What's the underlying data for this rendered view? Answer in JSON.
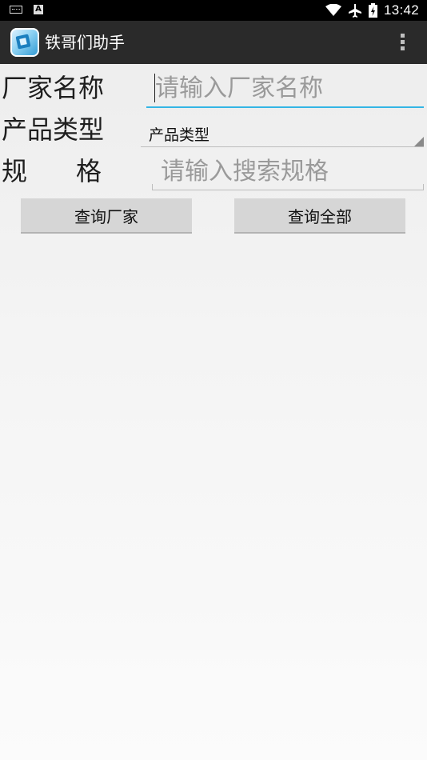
{
  "status_bar": {
    "time": "13:42",
    "left_icons": [
      "keyboard-icon",
      "a-notification-icon"
    ],
    "right_icons": [
      "wifi-icon",
      "airplane-icon",
      "battery-icon"
    ]
  },
  "action_bar": {
    "title": "铁哥们助手",
    "app_icon": "app-logo-icon",
    "overflow_icon": "overflow-menu-icon"
  },
  "form": {
    "manufacturer": {
      "label": "厂家名称",
      "placeholder": "请输入厂家名称",
      "value": ""
    },
    "product_type": {
      "label": "产品类型",
      "selected": "产品类型"
    },
    "spec": {
      "label": "规      格",
      "placeholder": "请输入搜索规格",
      "value": ""
    }
  },
  "buttons": {
    "query_manufacturer": "查询厂家",
    "query_all": "查询全部"
  },
  "colors": {
    "status_bar": "#000000",
    "action_bar": "#2a2a2a",
    "focus_accent": "#33b5e5",
    "button_bg": "#d6d6d6"
  }
}
